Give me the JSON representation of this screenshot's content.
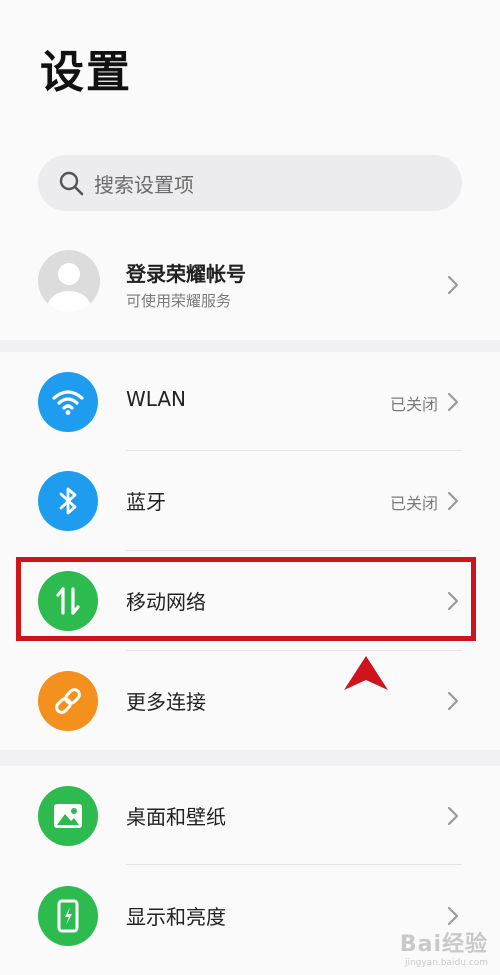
{
  "page": {
    "title": "设置"
  },
  "search": {
    "placeholder": "搜索设置项"
  },
  "account": {
    "title": "登录荣耀帐号",
    "subtitle": "可使用荣耀服务"
  },
  "group1": {
    "items": [
      {
        "label": "WLAN",
        "status": "已关闭",
        "icon": "wifi-icon",
        "color": "#1e9cf0"
      },
      {
        "label": "蓝牙",
        "status": "已关闭",
        "icon": "bluetooth-icon",
        "color": "#1e9cf0"
      },
      {
        "label": "移动网络",
        "status": "",
        "icon": "mobile-data-icon",
        "color": "#2dba4f"
      },
      {
        "label": "更多连接",
        "status": "",
        "icon": "link-icon",
        "color": "#f4911e"
      }
    ]
  },
  "group2": {
    "items": [
      {
        "label": "桌面和壁纸",
        "icon": "wallpaper-icon",
        "color": "#2dba4f"
      },
      {
        "label": "显示和亮度",
        "icon": "display-icon",
        "color": "#2dba4f"
      }
    ]
  },
  "annotation": {
    "highlight_color": "#d0141b"
  },
  "watermark": {
    "text": "Bai经验",
    "sub": "jingyan.baidu.com"
  }
}
